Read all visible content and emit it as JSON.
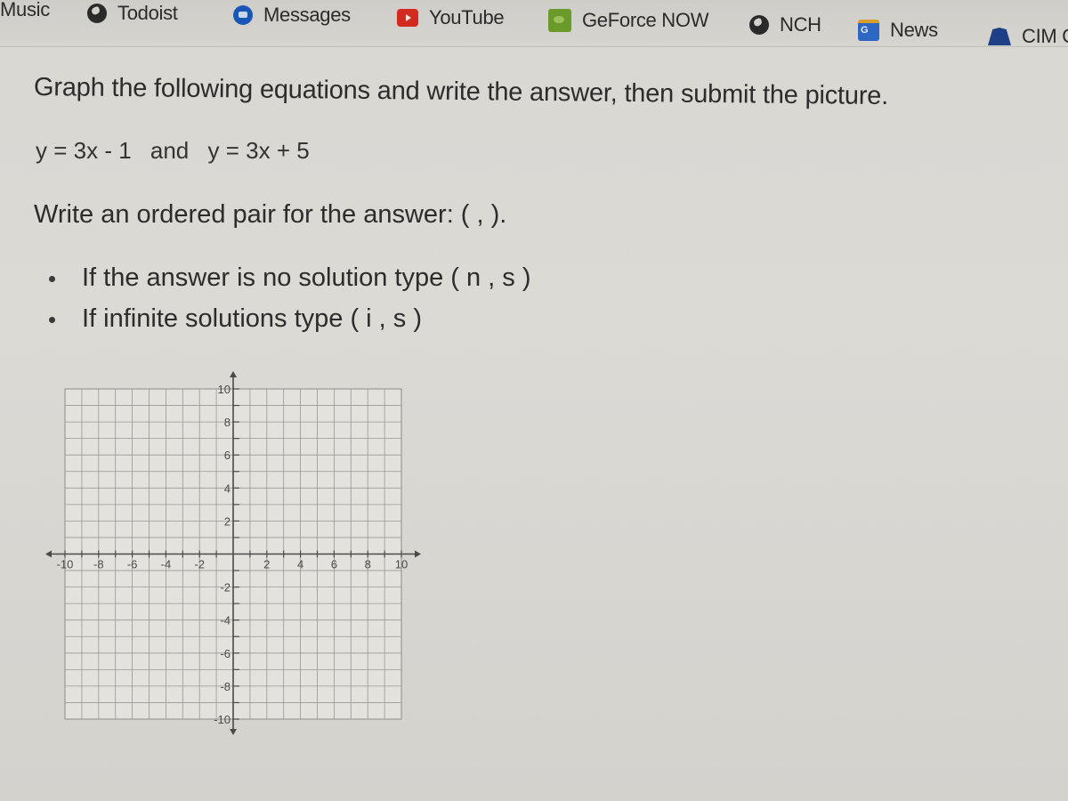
{
  "bookmarks_bar": {
    "items": [
      {
        "label": "Music",
        "icon": "none"
      },
      {
        "label": "Todoist",
        "icon": "globe-icon"
      },
      {
        "label": "Messages",
        "icon": "messages-icon"
      },
      {
        "label": "YouTube",
        "icon": "youtube-icon"
      },
      {
        "label": "GeForce NOW",
        "icon": "geforce-icon"
      },
      {
        "label": "NCH",
        "icon": "globe-icon"
      },
      {
        "label": "News",
        "icon": "google-news-icon"
      },
      {
        "label": "CIM Op",
        "icon": "cim-icon"
      }
    ]
  },
  "worksheet": {
    "title": "Graph the following equations and write the answer, then submit the picture.",
    "equation_1": "y = 3x - 1",
    "connector": "and",
    "equation_2": "y = 3x + 5",
    "prompt": "Write an ordered pair for the answer: (  ,   ).",
    "bullets": [
      "If the answer is no solution type ( n , s )",
      "If infinite solutions type ( i , s )"
    ]
  },
  "graph": {
    "x_range": [
      -10,
      10
    ],
    "y_range": [
      -10,
      10
    ],
    "grid_step": 1,
    "x_tick_labels": [
      "-10",
      "-8",
      "-6",
      "-4",
      "-2",
      "2",
      "4",
      "6",
      "8",
      "10"
    ],
    "y_tick_labels": [
      "10",
      "8",
      "6",
      "4",
      "2",
      "-2",
      "-4",
      "-6",
      "-8",
      "-10"
    ],
    "plotted_lines": []
  }
}
